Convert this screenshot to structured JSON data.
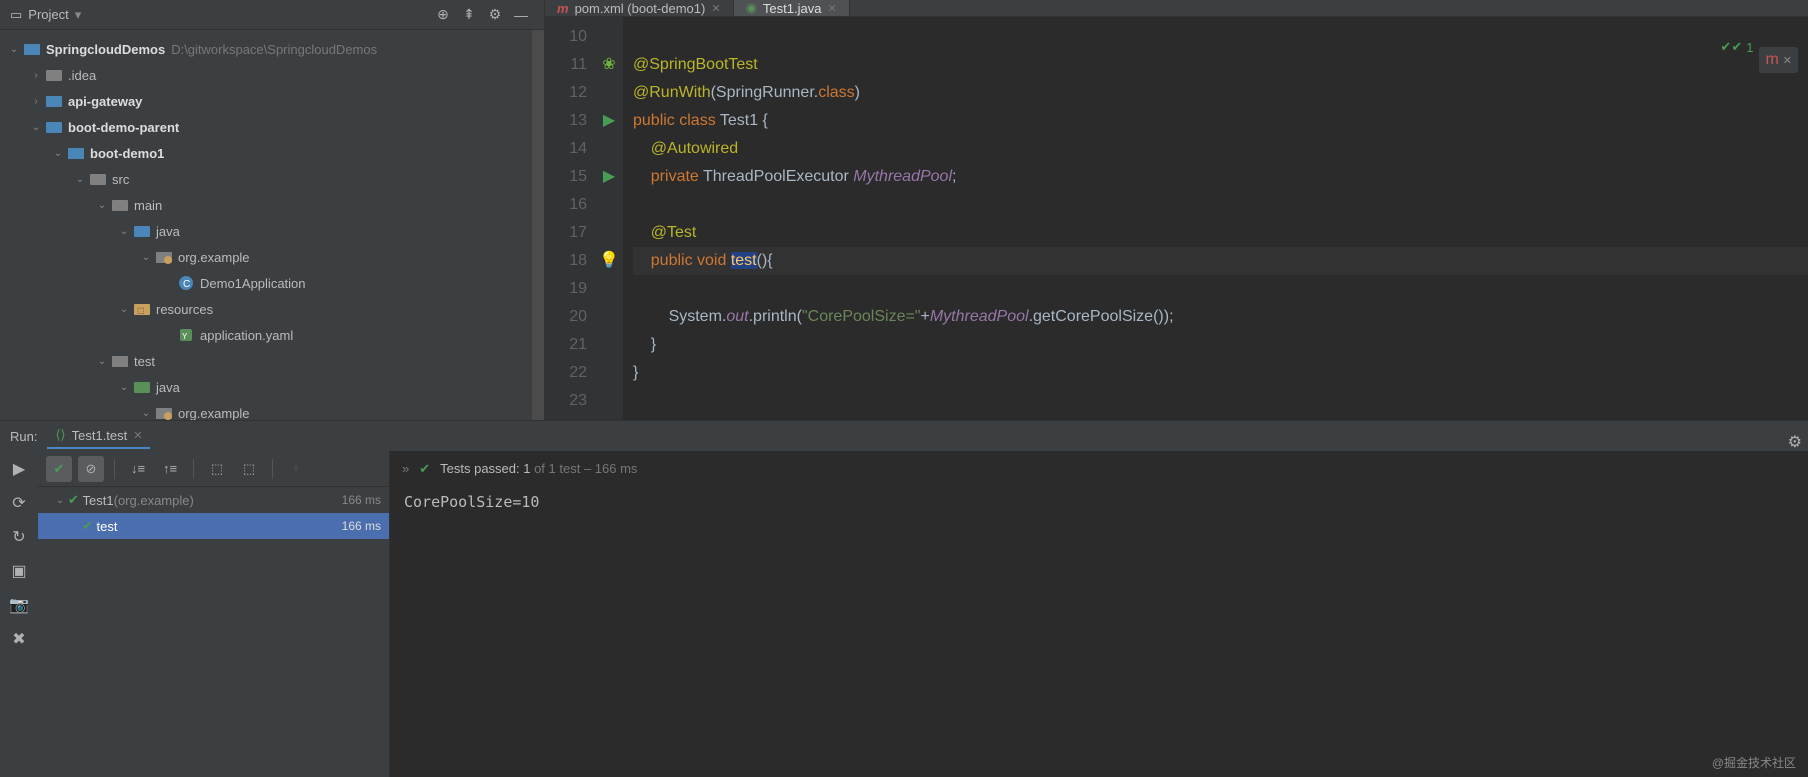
{
  "project": {
    "header": "Project",
    "root": {
      "name": "SpringcloudDemos",
      "path": "D:\\gitworkspace\\SpringcloudDemos"
    },
    "tree": [
      {
        "indent": 1,
        "chev": "›",
        "icon": "folder-grey",
        "name": ".idea"
      },
      {
        "indent": 1,
        "chev": "›",
        "icon": "folder-blue",
        "name": "api-gateway",
        "bold": true
      },
      {
        "indent": 1,
        "chev": "⌄",
        "icon": "folder-blue",
        "name": "boot-demo-parent",
        "bold": true
      },
      {
        "indent": 2,
        "chev": "⌄",
        "icon": "folder-blue",
        "name": "boot-demo1",
        "bold": true
      },
      {
        "indent": 3,
        "chev": "⌄",
        "icon": "folder-grey",
        "name": "src"
      },
      {
        "indent": 4,
        "chev": "⌄",
        "icon": "folder-grey",
        "name": "main"
      },
      {
        "indent": 5,
        "chev": "⌄",
        "icon": "folder-blue",
        "name": "java"
      },
      {
        "indent": 6,
        "chev": "⌄",
        "icon": "package",
        "name": "org.example"
      },
      {
        "indent": 7,
        "chev": "",
        "icon": "class",
        "name": "Demo1Application"
      },
      {
        "indent": 5,
        "chev": "⌄",
        "icon": "resources",
        "name": "resources"
      },
      {
        "indent": 7,
        "chev": "",
        "icon": "yaml",
        "name": "application.yaml"
      },
      {
        "indent": 4,
        "chev": "⌄",
        "icon": "folder-grey",
        "name": "test"
      },
      {
        "indent": 5,
        "chev": "⌄",
        "icon": "folder-green",
        "name": "java"
      },
      {
        "indent": 6,
        "chev": "⌄",
        "icon": "package",
        "name": "org.example"
      }
    ]
  },
  "editor": {
    "tabs": [
      {
        "icon": "m",
        "label": "pom.xml (boot-demo1)",
        "active": false
      },
      {
        "icon": "j",
        "label": "Test1.java",
        "active": true
      }
    ],
    "status_passed": "1",
    "lines": [
      {
        "n": "10"
      },
      {
        "n": "11",
        "g": "spring"
      },
      {
        "n": "12"
      },
      {
        "n": "13",
        "g": "run"
      },
      {
        "n": "14"
      },
      {
        "n": "15",
        "g": "run"
      },
      {
        "n": "16"
      },
      {
        "n": "17"
      },
      {
        "n": "18",
        "g": "run",
        "bulb": true,
        "hl": true
      },
      {
        "n": "19"
      },
      {
        "n": "20"
      },
      {
        "n": "21"
      },
      {
        "n": "22"
      },
      {
        "n": "23"
      }
    ],
    "tokens": {
      "l11": {
        "ann": "@SpringBootTest"
      },
      "l12": {
        "ann": "@RunWith",
        "p1": "(SpringRunner.",
        "kw": "class",
        "p2": ")"
      },
      "l13": {
        "k1": "public class ",
        "id": "Test1 {"
      },
      "l14": {
        "ann": "@Autowired"
      },
      "l15": {
        "k1": "private ",
        "id": "ThreadPoolExecutor ",
        "fld": "MythreadPool",
        "p": ";"
      },
      "l17": {
        "ann": "@Test"
      },
      "l18": {
        "k1": "public void ",
        "mth": "test",
        "p": "(){"
      },
      "l20": {
        "id1": "System.",
        "stat": "out",
        "id2": ".println(",
        "str": "\"CorePoolSize=\"",
        "id3": "+",
        "fld": "MythreadPool",
        "id4": ".getCorePoolSize());"
      },
      "l21": {
        "p": "}"
      },
      "l22": {
        "p": "}"
      }
    }
  },
  "run": {
    "label": "Run:",
    "tab": "Test1.test",
    "summary_prefix": "Tests passed: 1",
    "summary_suffix": " of 1 test – 166 ms",
    "tree": [
      {
        "name": "Test1",
        "pkg": "(org.example)",
        "time": "166 ms",
        "sel": false
      },
      {
        "name": "test",
        "time": "166 ms",
        "sel": true
      }
    ],
    "output": "CorePoolSize=10"
  },
  "watermark": "@掘金技术社区"
}
